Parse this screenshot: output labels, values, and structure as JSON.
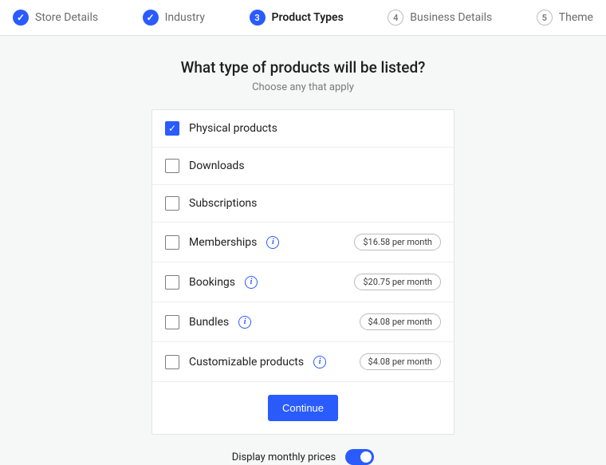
{
  "stepper": {
    "steps": [
      {
        "label": "Store Details",
        "state": "done"
      },
      {
        "label": "Industry",
        "state": "done"
      },
      {
        "label": "Product Types",
        "state": "current",
        "num": "3"
      },
      {
        "label": "Business Details",
        "state": "future",
        "num": "4"
      },
      {
        "label": "Theme",
        "state": "future",
        "num": "5"
      }
    ]
  },
  "heading": "What type of products will be listed?",
  "subheading": "Choose any that apply",
  "product_types": [
    {
      "label": "Physical products",
      "checked": true,
      "info": false,
      "price": null
    },
    {
      "label": "Downloads",
      "checked": false,
      "info": false,
      "price": null
    },
    {
      "label": "Subscriptions",
      "checked": false,
      "info": false,
      "price": null
    },
    {
      "label": "Memberships",
      "checked": false,
      "info": true,
      "price": "$16.58 per month"
    },
    {
      "label": "Bookings",
      "checked": false,
      "info": true,
      "price": "$20.75 per month"
    },
    {
      "label": "Bundles",
      "checked": false,
      "info": true,
      "price": "$4.08 per month"
    },
    {
      "label": "Customizable products",
      "checked": false,
      "info": true,
      "price": "$4.08 per month"
    }
  ],
  "continue_label": "Continue",
  "toggle": {
    "label": "Display monthly prices",
    "on": true
  },
  "colors": {
    "accent": "#2a5bff"
  }
}
